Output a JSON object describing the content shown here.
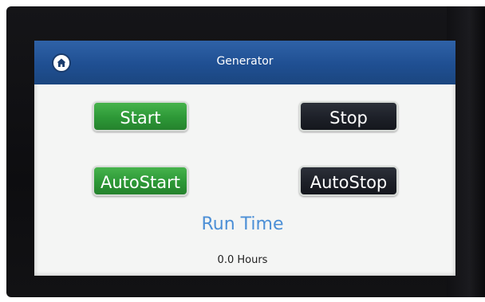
{
  "header": {
    "title": "Generator",
    "home_icon": "home-icon"
  },
  "buttons": {
    "start": "Start",
    "stop": "Stop",
    "autostart": "AutoStart",
    "autostop": "AutoStop"
  },
  "run_time": {
    "label": "Run Time",
    "value": "0.0 Hours"
  },
  "colors": {
    "header_blue": "#1f4f92",
    "green_button": "#2d9837",
    "dark_button": "#1d2028",
    "run_time_blue": "#4c8fd6"
  }
}
